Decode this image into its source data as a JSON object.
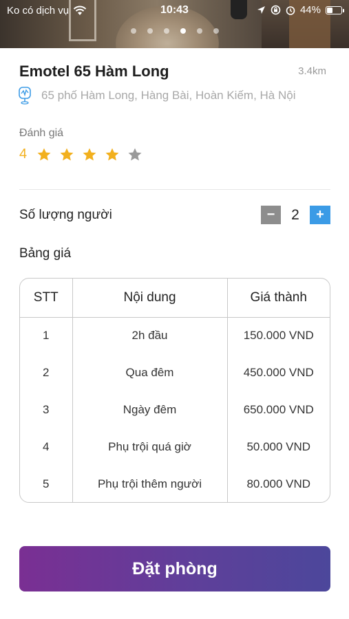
{
  "status_bar": {
    "carrier": "Ko có dịch vụ",
    "time": "10:43",
    "battery": "44%",
    "battery_level": 0.44
  },
  "gallery": {
    "slide_count": 6,
    "active_slide": 4
  },
  "hotel": {
    "name": "Emotel 65 Hàm Long",
    "distance": "3.4km",
    "address": "65 phố Hàm Long, Hàng Bài, Hoàn Kiếm, Hà Nội"
  },
  "rating": {
    "label": "Đánh giá",
    "value": "4",
    "stars_filled": 4,
    "stars_total": 5,
    "star_color": "#f2b01e",
    "star_empty_color": "#9a9a9a"
  },
  "quantity": {
    "label": "Số lượng người",
    "value": "2",
    "minus": "−",
    "plus": "+"
  },
  "price_table": {
    "label": "Bảng giá",
    "headers": [
      "STT",
      "Nội dung",
      "Giá thành"
    ],
    "rows": [
      [
        "1",
        "2h đầu",
        "150.000 VND"
      ],
      [
        "2",
        "Qua đêm",
        "450.000 VND"
      ],
      [
        "3",
        "Ngày đêm",
        "650.000 VND"
      ],
      [
        "4",
        "Phụ trội quá giờ",
        "50.000 VND"
      ],
      [
        "5",
        "Phụ trội thêm người",
        "80.000 VND"
      ]
    ]
  },
  "actions": {
    "book_label": "Đặt phòng"
  },
  "icons": {
    "wifi": "wifi-icon",
    "location_arrow": "location-arrow-icon",
    "orientation_lock": "orientation-lock-icon",
    "alarm": "alarm-icon",
    "address_pin": "map-pin-icon"
  }
}
